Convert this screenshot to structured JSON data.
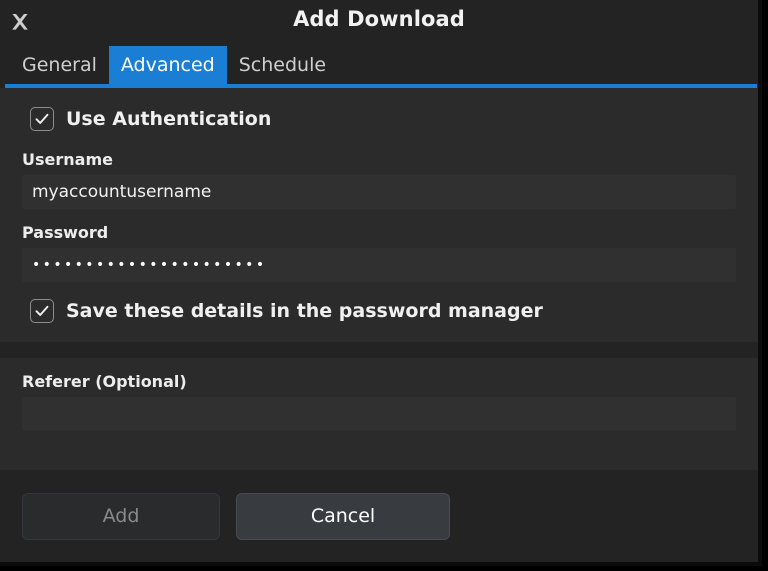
{
  "window": {
    "title": "Add Download",
    "close_icon": "close-x-icon"
  },
  "tabs": [
    {
      "label": "General",
      "active": false
    },
    {
      "label": "Advanced",
      "active": true
    },
    {
      "label": "Schedule",
      "active": false
    }
  ],
  "advanced": {
    "use_auth": {
      "label": "Use Authentication",
      "checked": true,
      "check_glyph": "checkmark-icon"
    },
    "username": {
      "label": "Username",
      "value": "myaccountusername",
      "placeholder": ""
    },
    "password": {
      "label": "Password",
      "value": "••••••••••••••••••••••",
      "placeholder": ""
    },
    "save_details": {
      "label": "Save these details in the password manager",
      "checked": true,
      "check_glyph": "checkmark-icon"
    },
    "referer": {
      "label": "Referer (Optional)",
      "value": "",
      "placeholder": ""
    }
  },
  "footer": {
    "add_label": "Add",
    "add_enabled": false,
    "cancel_label": "Cancel",
    "cancel_enabled": true
  },
  "colors": {
    "accent": "#1a7fd4",
    "dialog_bg": "#2b2b2b",
    "bar_bg": "#232323",
    "input_bg": "#303030",
    "text": "#f0f0f0",
    "text_muted": "#8a8a8a"
  }
}
